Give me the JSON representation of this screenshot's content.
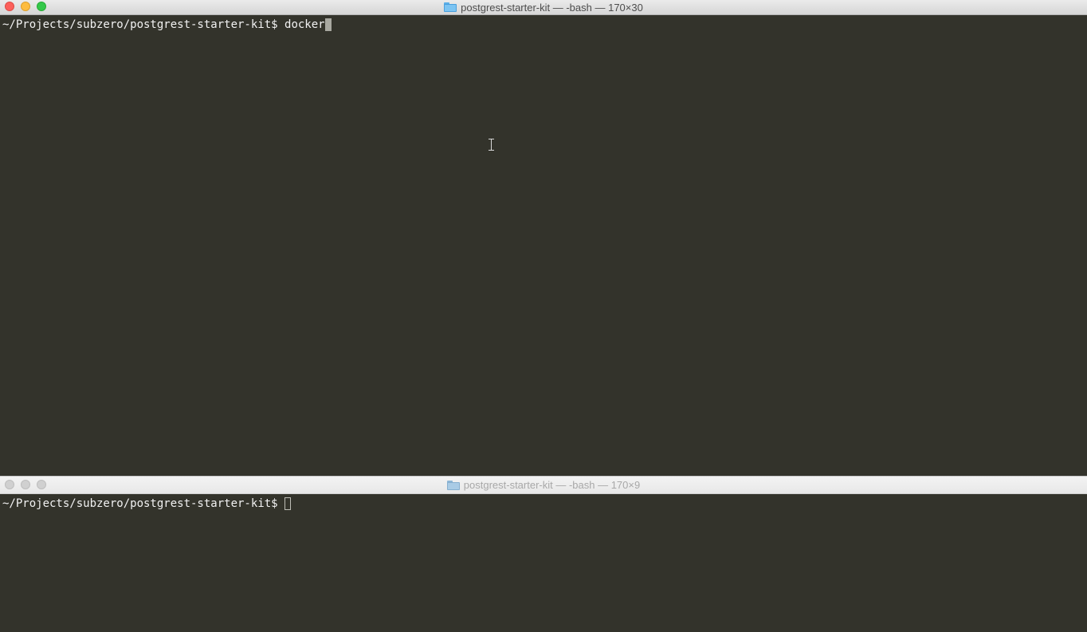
{
  "top_window": {
    "title": "postgrest-starter-kit — -bash — 170×30",
    "prompt": "~/Projects/subzero/postgrest-starter-kit$ ",
    "command": "docker"
  },
  "bottom_window": {
    "title": "postgrest-starter-kit — -bash — 170×9",
    "prompt": "~/Projects/subzero/postgrest-starter-kit$ ",
    "command": ""
  },
  "icons": {
    "folder": "folder-icon",
    "pointer": "ibeam-cursor-icon"
  },
  "colors": {
    "terminal_bg": "#33332b",
    "terminal_fg": "#f2f2f2",
    "close": "#fc605b",
    "minimize": "#fdbc40",
    "zoom": "#34c84a"
  }
}
